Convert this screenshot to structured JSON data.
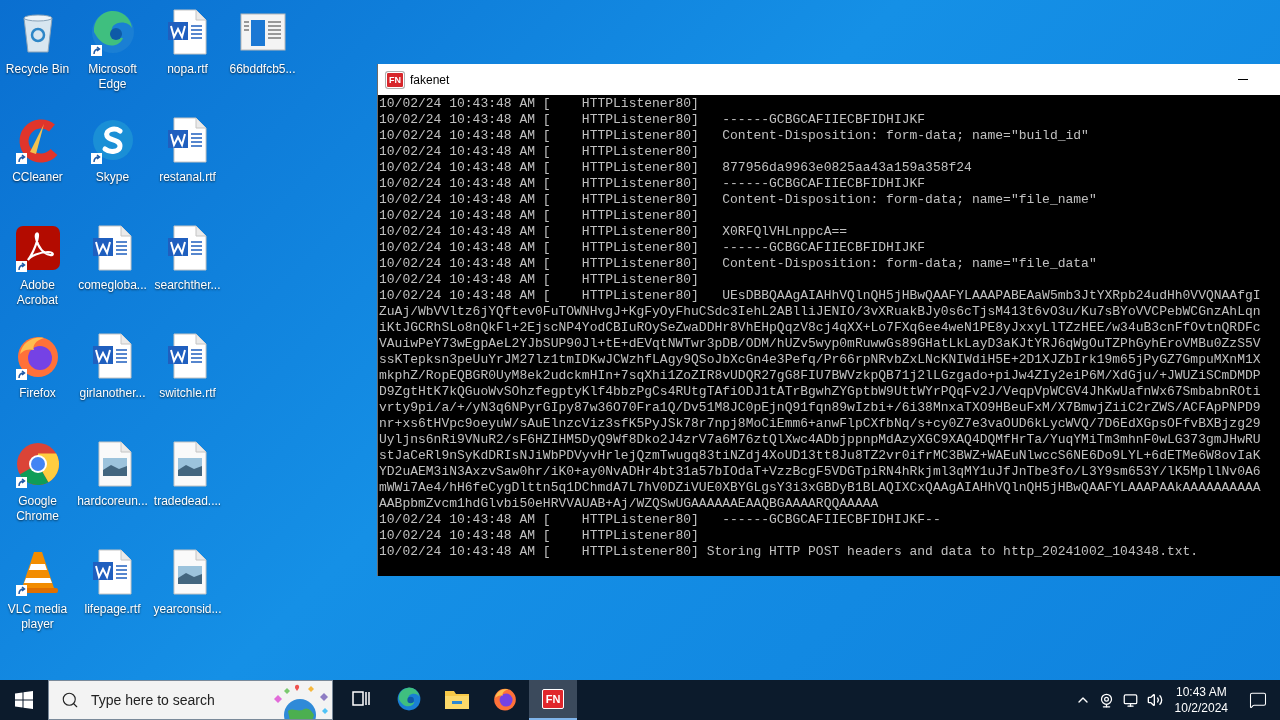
{
  "desktop_icons": [
    {
      "label": "Recycle Bin",
      "kind": "recycle",
      "shortcut": false
    },
    {
      "label": "CCleaner",
      "kind": "ccleaner",
      "shortcut": true
    },
    {
      "label": "Adobe Acrobat",
      "kind": "acrobat",
      "shortcut": true
    },
    {
      "label": "Firefox",
      "kind": "firefox",
      "shortcut": true
    },
    {
      "label": "Google Chrome",
      "kind": "chrome",
      "shortcut": true
    },
    {
      "label": "VLC media player",
      "kind": "vlc",
      "shortcut": true
    },
    {
      "label": "Microsoft Edge",
      "kind": "edge",
      "shortcut": true
    },
    {
      "label": "Skype",
      "kind": "skype",
      "shortcut": true
    },
    {
      "label": "comegloba...",
      "kind": "word",
      "shortcut": false
    },
    {
      "label": "girlanother...",
      "kind": "word",
      "shortcut": false
    },
    {
      "label": "hardcoreun...",
      "kind": "image",
      "shortcut": false
    },
    {
      "label": "lifepage.rtf",
      "kind": "word",
      "shortcut": false
    },
    {
      "label": "nopa.rtf",
      "kind": "word",
      "shortcut": false
    },
    {
      "label": "restanal.rtf",
      "kind": "word",
      "shortcut": false
    },
    {
      "label": "searchther...",
      "kind": "word",
      "shortcut": false
    },
    {
      "label": "switchle.rtf",
      "kind": "word",
      "shortcut": false
    },
    {
      "label": "tradedead....",
      "kind": "image",
      "shortcut": false
    },
    {
      "label": "yearconsid...",
      "kind": "image",
      "shortcut": false
    },
    {
      "label": "66bddfcb5...",
      "kind": "app",
      "shortcut": false
    }
  ],
  "console_window": {
    "icon_text": "FN",
    "title": "fakenet",
    "lines": [
      "10/02/24 10:43:48 AM [    HTTPListener80]",
      "10/02/24 10:43:48 AM [    HTTPListener80]   ------GCBGCAFIIECBFIDHIJKF",
      "10/02/24 10:43:48 AM [    HTTPListener80]   Content-Disposition: form-data; name=\"build_id\"",
      "10/02/24 10:43:48 AM [    HTTPListener80]",
      "10/02/24 10:43:48 AM [    HTTPListener80]   877956da9963e0825aa43a159a358f24",
      "10/02/24 10:43:48 AM [    HTTPListener80]   ------GCBGCAFIIECBFIDHIJKF",
      "10/02/24 10:43:48 AM [    HTTPListener80]   Content-Disposition: form-data; name=\"file_name\"",
      "10/02/24 10:43:48 AM [    HTTPListener80]",
      "10/02/24 10:43:48 AM [    HTTPListener80]   X0RFQlVHLnppcA==",
      "10/02/24 10:43:48 AM [    HTTPListener80]   ------GCBGCAFIIECBFIDHIJKF",
      "10/02/24 10:43:48 AM [    HTTPListener80]   Content-Disposition: form-data; name=\"file_data\"",
      "10/02/24 10:43:48 AM [    HTTPListener80]",
      "10/02/24 10:43:48 AM [    HTTPListener80]   UEsDBBQAAgAIAHhVQlnQH5jHBwQAAFYLAAAPABEAaW5mb3JtYXRpb24udHh0VVQNAAfgI",
      "ZuAj/WbVVltz6jYQftev0FuTOWNHvgJ+KgFyOyFhuCSdc3IehL2ABlliJENIO/3vXRuakBJy0s6cTjsM413t6vO3u/Ku7sBYoVVCPebWCGnzAhLqn",
      "iKtJGCRhSLo8nQkFl+2EjscNP4YodCBIuROySeZwaDDHr8VhEHpQqzV8cj4qXX+Lo7FXq6ee4weN1PE8yJxxyLlTZzHEE/w34uB3cnFfOvtnQRDFc",
      "VAuiwPeY73wEgpAeL2YJbSUP90Jl+tE+dEVqtNWTwr3pDB/ODM/hUZv5wyp0mRuwwGs89GHatLkLayD3aKJtYRJ6qWgOuTZPhGyhEroVMBu0ZzS5V",
      "ssKTepksn3peUuYrJM27lz1tmIDKwJCWzhfLAgy9QSoJbXcGn4e3Pefq/Pr66rpNRvbZxLNcKNIWdiH5E+2D1XJZbIrk19m65jPyGZ7GmpuMXnM1X",
      "mkphZ/RopEQBGR0UyM8ek2udckmHIn+7sqXhi1ZoZIR8vUDQR27gG8FIU7BWVzkpQB71j2lLGzgado+piJw4ZIy2eiP6M/XdGju/+JWUZiSCmDMDP",
      "D9ZgtHtK7kQGuoWvSOhzfegptyKlf4bbzPgCs4RUtgTAfiODJ1tATrBgwhZYGptbW9UttWYrPQqFv2J/VeqpVpWCGV4JhKwUafnWx67SmbabnROti",
      "vrty9pi/a/+/yN3q6NPyrGIpy87w36O70Fra1Q/Dv51M8JC0pEjnQ91fqn89wIzbi+/6i38MnxaTXO9HBeuFxM/X7BmwjZiiC2rZWS/ACFApPNPD9",
      "nr+xs6tHVpc9oeyuW/sAuElnzcViz3sfK5PyJSk78r7npj8MoCiEmm6+anwFlpCXfbNq/s+cy0Z7e3vaOUD6kLycWVQ/7D6EdXGpsOFfvBXBjzg29",
      "Uyljns6nRi9VNuR2/sF6HZIHM5DyQ9Wf8Dko2J4zrV7a6M76ztQlXwc4ADbjppnpMdAzyXGC9XAQ4DQMfHrTa/YuqYMiTm3mhnF0wLG373gmJHwRU",
      "stJaCeRl9nSyKdDRIsNJiWbPDVyvHrlejQzmTwugq83tiNZdj4XoUD13tt8Ju8TZ2vr0ifrMC3BWZ+WAEuNlwccS6NE6Do9LYL+6dETMe6W8ovIaK",
      "YD2uAEM3iN3AxzvSaw0hr/iK0+ay0NvADHr4bt31a57bIOdaT+VzzBcgF5VDGTpiRN4hRkjml3qMY1uJfJnTbe3fo/L3Y9sm653Y/lK5MpllNv0A6",
      "mWWi7Ae4/hH6feCygDlttn5q1DChmdA7L7hV0DZiVUE0XBYGLgsY3i3xGBDyB1BLAQIXCxQAAgAIAHhVQlnQH5jHBwQAAFYLAAAPAAkAAAAAAAAAA",
      "AABpbmZvcm1hdGlvbi50eHRVVAUAB+Aj/WZQSwUGAAAAAAEAAQBGAAAARQQAAAAA",
      "10/02/24 10:43:48 AM [    HTTPListener80]   ------GCBGCAFIIECBFIDHIJKF--",
      "10/02/24 10:43:48 AM [    HTTPListener80]",
      "10/02/24 10:43:48 AM [    HTTPListener80] Storing HTTP POST headers and data to http_20241002_104348.txt."
    ]
  },
  "taskbar": {
    "search": {
      "placeholder": "Type here to search"
    },
    "apps": [
      {
        "kind": "task-view",
        "selected": false
      },
      {
        "kind": "edge",
        "selected": false
      },
      {
        "kind": "explorer",
        "selected": false
      },
      {
        "kind": "firefox",
        "selected": false
      },
      {
        "kind": "fakenet",
        "label": "FN",
        "selected": true
      }
    ],
    "clock": {
      "time": "10:43 AM",
      "date": "10/2/2024"
    }
  }
}
